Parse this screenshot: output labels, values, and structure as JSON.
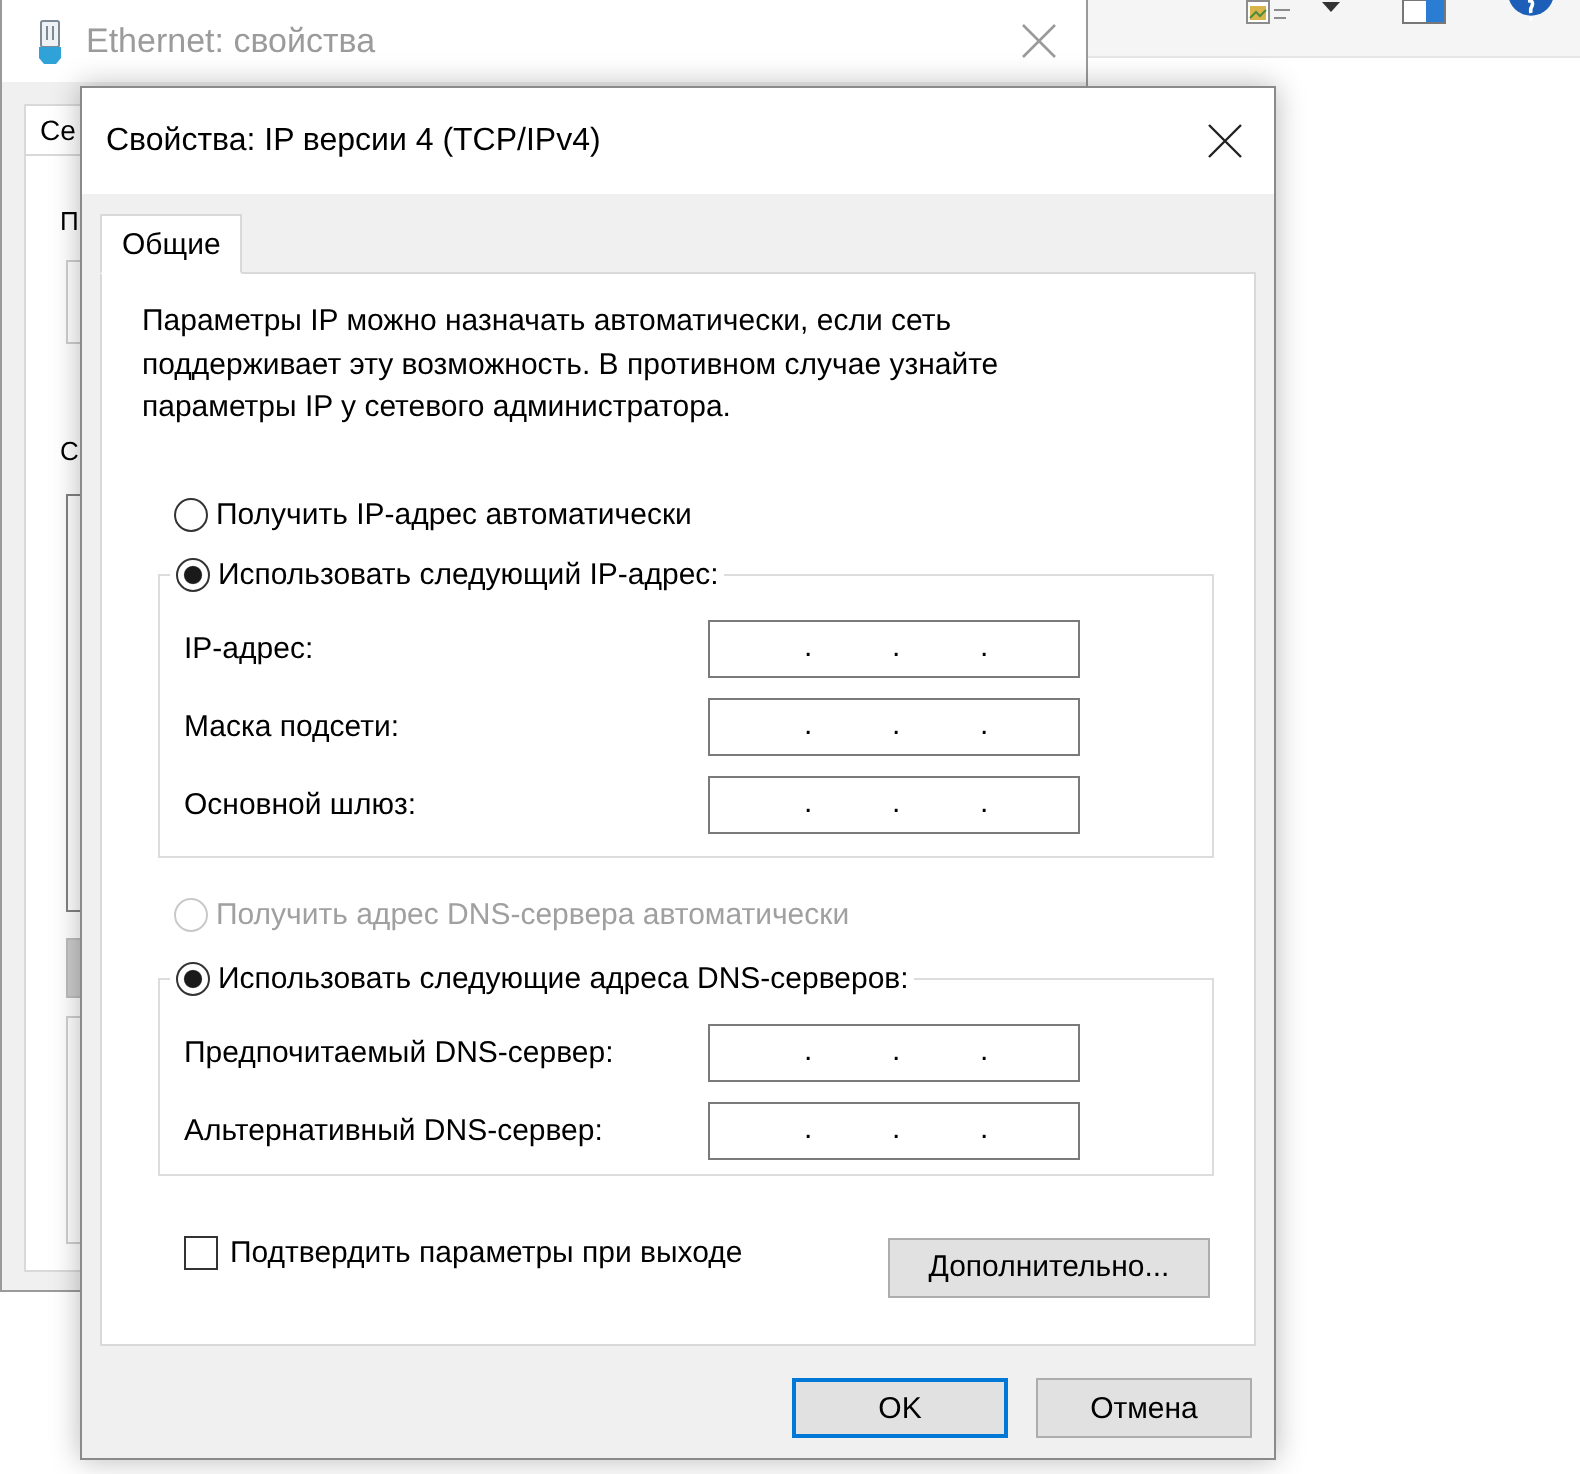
{
  "background_window": {
    "title": "Ethernet: свойства",
    "tab": "Се",
    "labels": [
      "П",
      "С"
    ]
  },
  "dialog": {
    "title": "Свойства: IP версии 4 (TCP/IPv4)",
    "tabs": [
      {
        "label": "Общие",
        "selected": true
      }
    ],
    "description": "Параметры IP можно назначать автоматически, если сеть поддерживает эту возможность. В противном случае узнайте параметры IP у сетевого администратора.",
    "ip_settings": {
      "options": [
        {
          "label": "Получить IP-адрес автоматически",
          "selected": false,
          "disabled": false
        },
        {
          "label": "Использовать следующий IP-адрес:",
          "selected": true,
          "disabled": false
        }
      ],
      "fields": [
        {
          "label": "IP-адрес:",
          "separators": [
            ".",
            ".",
            "."
          ]
        },
        {
          "label": "Маска подсети:",
          "separators": [
            ".",
            ".",
            "."
          ]
        },
        {
          "label": "Основной шлюз:",
          "separators": [
            ".",
            ".",
            "."
          ]
        }
      ]
    },
    "dns_settings": {
      "options": [
        {
          "label": "Получить адрес DNS-сервера автоматически",
          "selected": false,
          "disabled": true
        },
        {
          "label": "Использовать следующие адреса DNS-серверов:",
          "selected": true,
          "disabled": false
        }
      ],
      "fields": [
        {
          "label": "Предпочитаемый DNS-сервер:",
          "separators": [
            ".",
            ".",
            "."
          ]
        },
        {
          "label": "Альтернативный DNS-сервер:",
          "separators": [
            ".",
            ".",
            "."
          ]
        }
      ]
    },
    "validate_on_exit": {
      "label": "Подтвердить параметры при выходе",
      "checked": false
    },
    "advanced_button": "Дополнительно...",
    "buttons": [
      {
        "label": "OK",
        "default": true
      },
      {
        "label": "Отмена",
        "default": false
      }
    ]
  }
}
